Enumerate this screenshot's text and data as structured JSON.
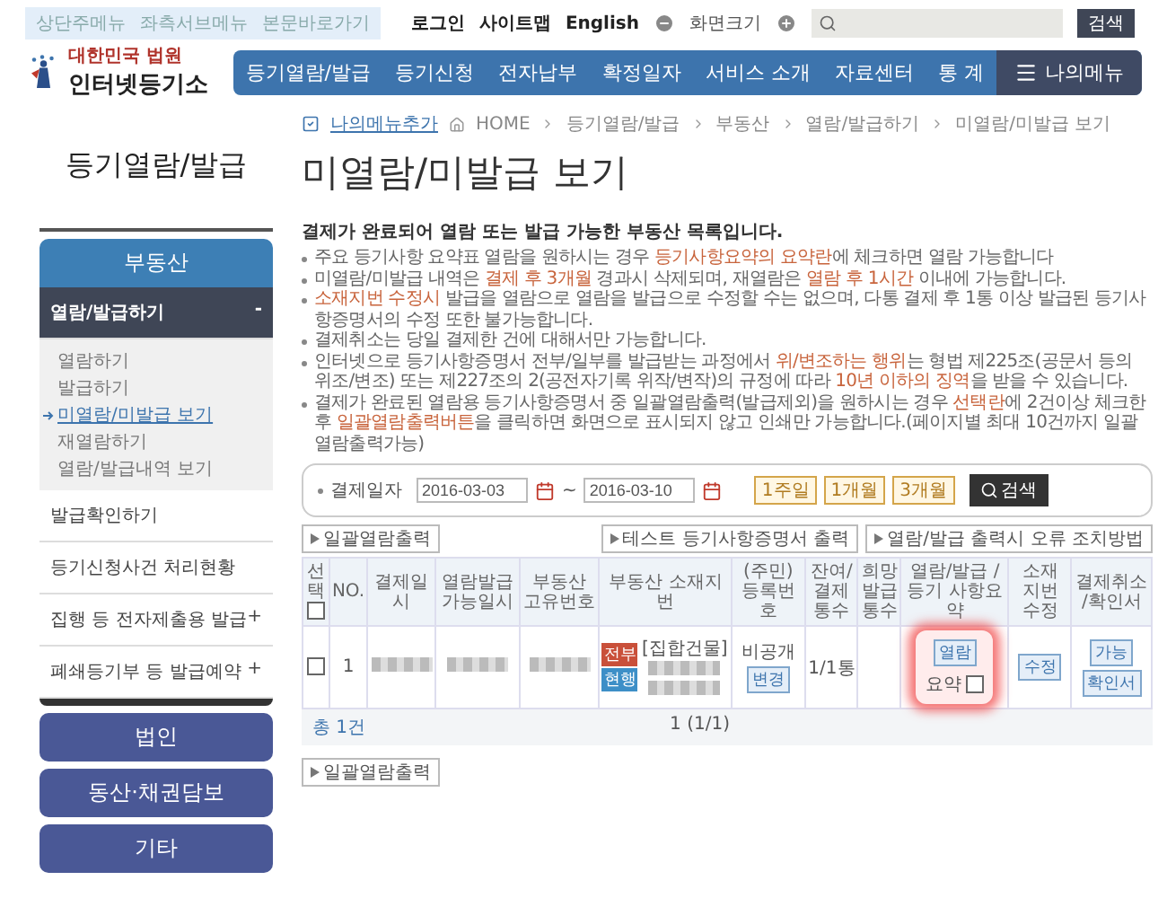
{
  "skip_links": [
    "상단주메뉴",
    "좌측서브메뉴",
    "본문바로가기"
  ],
  "utility_links": [
    "로그인",
    "사이트맵",
    "English"
  ],
  "font_size": {
    "label": "화면크기"
  },
  "search": {
    "button": "검색"
  },
  "logo": {
    "subtitle": "대한민국 법원",
    "title": "인터넷등기소"
  },
  "nav": {
    "items": [
      "등기열람/발급",
      "등기신청",
      "전자납부",
      "확정일자",
      "서비스 소개",
      "자료센터",
      "통 계"
    ],
    "my_menu": "나의메뉴"
  },
  "sidebar": {
    "title": "등기열람/발급",
    "sections": [
      {
        "label": "부동산",
        "selected": true,
        "groups": [
          {
            "label": "열람/발급하기",
            "toggle": "-",
            "expanded": true,
            "children": [
              {
                "label": "열람하기",
                "selected": false
              },
              {
                "label": "발급하기",
                "selected": false
              },
              {
                "label": "미열람/미발급 보기",
                "selected": true
              },
              {
                "label": "재열람하기",
                "selected": false
              },
              {
                "label": "열람/발급내역 보기",
                "selected": false
              }
            ]
          },
          {
            "label": "발급확인하기",
            "expanded": false
          },
          {
            "label": "등기신청사건 처리현황",
            "expanded": false
          },
          {
            "label": "집행 등 전자제출용 발급",
            "toggle": "+",
            "expanded": false
          },
          {
            "label": "폐쇄등기부 등 발급예약",
            "toggle": "+",
            "expanded": false
          }
        ]
      },
      {
        "label": "법인",
        "selected": false
      },
      {
        "label": "동산·채권담보",
        "selected": false
      },
      {
        "label": "기타",
        "selected": false
      }
    ]
  },
  "breadcrumb": {
    "add_link": "나의메뉴추가",
    "items": [
      "HOME",
      "등기열람/발급",
      "부동산",
      "열람/발급하기",
      "미열람/미발급 보기"
    ]
  },
  "page_title": "미열람/미발급 보기",
  "intro": "결제가 완료되어 열람 또는 발급 가능한 부동산 목록입니다.",
  "notes": [
    [
      {
        "text": "주요 등기사항 요약표 열람을 원하시는 경우 ",
        "emphasis": false
      },
      {
        "text": "등기사항요약의 요약란",
        "emphasis": true
      },
      {
        "text": "에 체크하면 열람 가능합니다",
        "emphasis": false
      }
    ],
    [
      {
        "text": "미열람/미발급 내역은 ",
        "emphasis": false
      },
      {
        "text": "결제 후 3개월",
        "emphasis": true
      },
      {
        "text": " 경과시 삭제되며, 재열람은 ",
        "emphasis": false
      },
      {
        "text": "열람 후 1시간",
        "emphasis": true
      },
      {
        "text": " 이내에 가능합니다.",
        "emphasis": false
      }
    ],
    [
      {
        "text": "소재지번 수정시",
        "emphasis": true
      },
      {
        "text": " 발급을 열람으로 열람을 발급으로 수정할 수는 없으며, 다통 결제 후 1통 이상 발급된 등기사항증명서의 수정 또한 불가능합니다.",
        "emphasis": false
      }
    ],
    [
      {
        "text": "결제취소는 당일 결제한 건에 대해서만 가능합니다.",
        "emphasis": false
      }
    ],
    [
      {
        "text": "인터넷으로 등기사항증명서 전부/일부를 발급받는 과정에서 ",
        "emphasis": false
      },
      {
        "text": "위/변조하는 행위",
        "emphasis": true
      },
      {
        "text": "는 형법 제225조(공문서 등의 위조/변조) 또는 제227조의 2(공전자기록 위작/변작)의 규정에 따라 ",
        "emphasis": false
      },
      {
        "text": "10년 이하의 징역",
        "emphasis": true
      },
      {
        "text": "을 받을 수 있습니다.",
        "emphasis": false
      }
    ],
    [
      {
        "text": "결제가 완료된 열람용 등기사항증명서 중 일괄열람출력(발급제외)을 원하시는 경우 ",
        "emphasis": false
      },
      {
        "text": "선택란",
        "emphasis": true
      },
      {
        "text": "에 2건이상 체크한 후 ",
        "emphasis": false
      },
      {
        "text": "일괄열람출력버튼",
        "emphasis": true
      },
      {
        "text": "을 클릭하면 화면으로 표시되지 않고 인쇄만 가능합니다.(페이지별 최대 10건까지 일괄열람출력가능)",
        "emphasis": false
      }
    ]
  ],
  "filter": {
    "label": "결제일자",
    "from": "2016-03-03",
    "separator": "~",
    "to": "2016-03-10",
    "periods": [
      "1주일",
      "1개월",
      "3개월"
    ],
    "search": "검색"
  },
  "actions": {
    "batch_print": "일괄열람출력",
    "right": [
      "테스트 등기사항증명서 출력",
      "열람/발급 출력시 오류 조치방법"
    ]
  },
  "table": {
    "select_all_checked": false,
    "columns": [
      "선택",
      "NO.",
      "결제일시",
      "열람발급 가능일시",
      "부동산 고유번호",
      "부동산 소재지번",
      "(주민) 등록번호",
      "잔여/ 결제 통수",
      "희망 발급 통수",
      "열람/발급 /등기 사항요약",
      "소재 지번 수정",
      "결제취소 /확인서"
    ],
    "rows": [
      {
        "checked": false,
        "no": "1",
        "address_type": "[집합건물]",
        "scope": "전부",
        "status": "현행",
        "registration": "비공개",
        "change": "변경",
        "copies": "1/1통",
        "view": "열람",
        "summary_label": "요약",
        "summary_checked": false,
        "highlighted": true,
        "edit": "수정",
        "cancel": "가능",
        "certificate": "확인서"
      }
    ]
  },
  "footer": {
    "total": "총 1건",
    "pages": "1 (1/1)"
  },
  "bottom_action": "일괄열람출력"
}
